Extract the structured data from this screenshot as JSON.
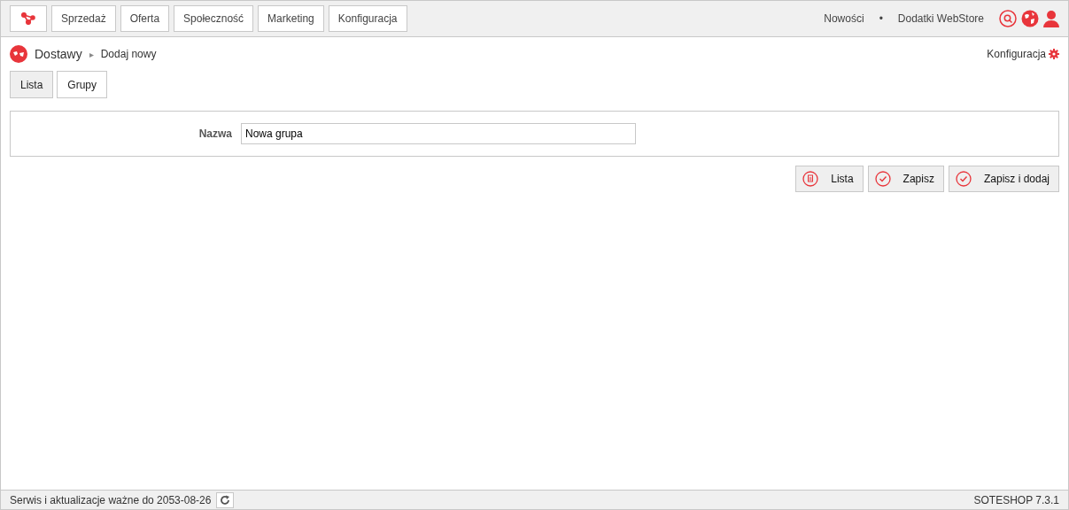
{
  "top_menu": [
    {
      "label": "Sprzedaż"
    },
    {
      "label": "Oferta"
    },
    {
      "label": "Społeczność"
    },
    {
      "label": "Marketing"
    },
    {
      "label": "Konfiguracja"
    }
  ],
  "top_links": [
    "Nowości",
    "•",
    "Dodatki WebStore"
  ],
  "breadcrumb": {
    "module": "Dostawy",
    "separator": "▸",
    "current": "Dodaj nowy"
  },
  "config_link": "Konfiguracja",
  "tabs": [
    {
      "label": "Lista",
      "selected": true
    },
    {
      "label": "Grupy",
      "selected": false
    }
  ],
  "form": {
    "fields": [
      {
        "label": "Nazwa",
        "value": "Nowa grupa"
      }
    ]
  },
  "actions": [
    {
      "label": "Lista",
      "kind": "list"
    },
    {
      "label": "Zapisz",
      "kind": "save"
    },
    {
      "label": "Zapisz i dodaj",
      "kind": "save"
    }
  ],
  "status_bar": {
    "text": "Serwis i aktualizacje ważne do 2053-08-26",
    "version": "SOTESHOP 7.3.1"
  }
}
